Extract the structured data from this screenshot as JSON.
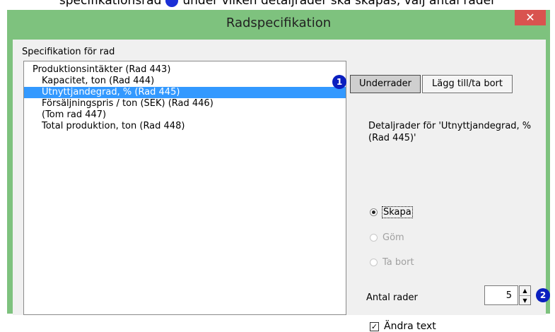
{
  "caption": {
    "before": "specifikationsrad",
    "after": "under vilken detaljrader ska skapas, välj antal rader"
  },
  "window": {
    "title": "Radspecifikation",
    "close_glyph": "✕"
  },
  "spec_label": "Specifikation för rad",
  "rows": [
    "Produktionsintäkter (Rad 443)",
    "Kapacitet, ton (Rad 444)",
    "Utnyttjandegrad, % (Rad 445)",
    "Försäljningspris / ton (SEK) (Rad 446)",
    "(Tom rad 447)",
    "Total produktion, ton (Rad 448)"
  ],
  "selected_row": 2,
  "markers": {
    "one": "1",
    "two": "2"
  },
  "tabs": {
    "underrader": "Underrader",
    "lagg_till": "Lägg till/ta bort"
  },
  "detail_text": "Detaljrader för 'Utnyttjandegrad, % (Rad 445)'",
  "options": {
    "skapa": "Skapa",
    "gom": "Göm",
    "ta_bort": "Ta bort"
  },
  "count_label": "Antal rader",
  "count_value": "5",
  "checkbox": {
    "label": "Ändra text",
    "checked": true,
    "mark": "✓"
  },
  "colors": {
    "frame": "#7ec27e",
    "close": "#d9534f",
    "selection": "#3399ff",
    "marker": "#0a1fbf"
  }
}
